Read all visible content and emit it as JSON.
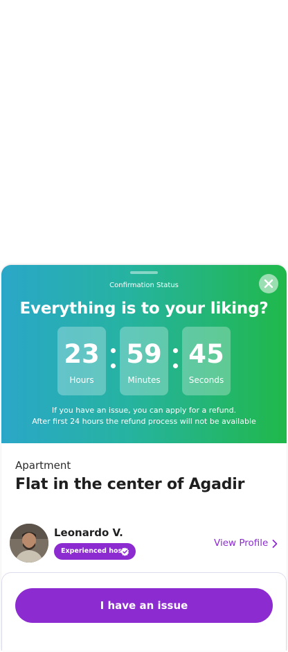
{
  "modal": {
    "status_label": "Confirmation Status",
    "headline": "Everything is to your liking?",
    "timer": [
      {
        "value": "23",
        "unit": "Hours"
      },
      {
        "value": "59",
        "unit": "Minutes"
      },
      {
        "value": "45",
        "unit": "Seconds"
      }
    ],
    "note_line1": "If you have an issue, you can apply for a refund.",
    "note_line2": "After first 24 hours the refund process will not be available",
    "close_icon": "close-icon"
  },
  "listing": {
    "category": "Apartment",
    "title": "Flat in the center of Agadir"
  },
  "host": {
    "name": "Leonardo V.",
    "badge": "Experienced host",
    "badge_icon": "verified-check-icon",
    "view_profile": "View Profile"
  },
  "actions": {
    "issue_button": "I have an issue"
  },
  "colors": {
    "gradient_start": "#2aa7c8",
    "gradient_end": "#20b84a",
    "accent": "#8b2bd0"
  }
}
